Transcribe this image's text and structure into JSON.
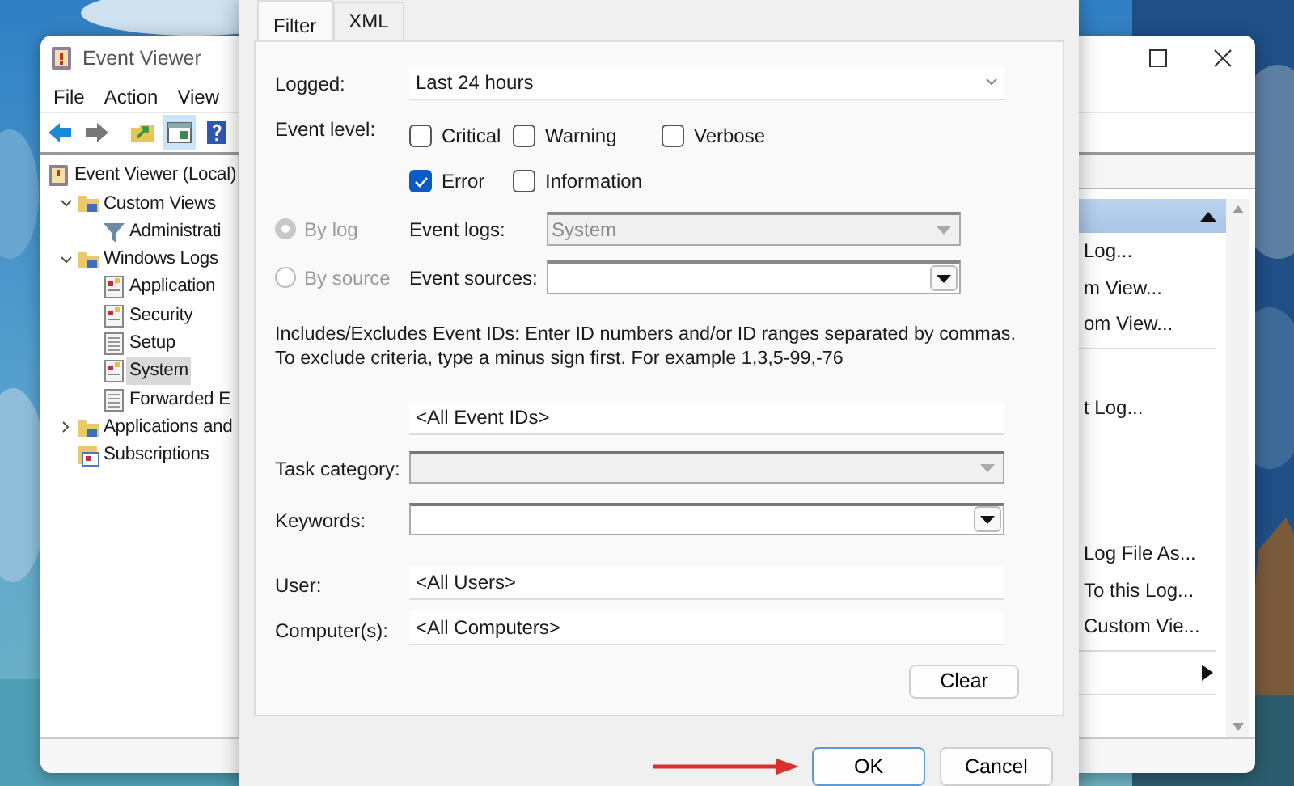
{
  "event_viewer": {
    "title": "Event Viewer",
    "menu": [
      "File",
      "Action",
      "View"
    ],
    "toolbar": [
      {
        "kind": "back",
        "selected": false
      },
      {
        "kind": "forward",
        "selected": false
      },
      {
        "kind": "up",
        "selected": false
      },
      {
        "kind": "pane",
        "selected": true
      },
      {
        "kind": "help",
        "selected": false
      }
    ],
    "tree": [
      {
        "label": "Event Viewer (Local)",
        "kind": "root",
        "selected": false,
        "children": [
          {
            "label": "Custom Views",
            "kind": "folder",
            "selected": false,
            "expanded": true,
            "children": [
              {
                "label": "Administrati",
                "kind": "filter",
                "selected": false
              }
            ]
          },
          {
            "label": "Windows Logs",
            "kind": "folder",
            "selected": false,
            "expanded": true,
            "children": [
              {
                "label": "Application",
                "kind": "log",
                "selected": false
              },
              {
                "label": "Security",
                "kind": "log",
                "selected": false
              },
              {
                "label": "Setup",
                "kind": "plainlog",
                "selected": false
              },
              {
                "label": "System",
                "kind": "log",
                "selected": true
              },
              {
                "label": "Forwarded E",
                "kind": "plainlog",
                "selected": false
              }
            ]
          },
          {
            "label": "Applications and",
            "kind": "folder",
            "selected": false,
            "expanded": false
          },
          {
            "label": "Subscriptions",
            "kind": "subscriptions",
            "selected": false
          }
        ]
      }
    ],
    "actions": {
      "header_expanded": true,
      "items": [
        {
          "kind": "item",
          "label": "Log..."
        },
        {
          "kind": "item",
          "label": "m View..."
        },
        {
          "kind": "item",
          "label": "om View..."
        },
        {
          "kind": "separator"
        },
        {
          "kind": "space"
        },
        {
          "kind": "item",
          "label": "t Log..."
        },
        {
          "kind": "space"
        },
        {
          "kind": "space"
        },
        {
          "kind": "space"
        },
        {
          "kind": "item",
          "label": "Log File As..."
        },
        {
          "kind": "item",
          "label": "To this Log..."
        },
        {
          "kind": "item",
          "label": "Custom Vie..."
        },
        {
          "kind": "separator"
        },
        {
          "kind": "submenu"
        },
        {
          "kind": "separator"
        }
      ]
    }
  },
  "dialog": {
    "tabs": [
      {
        "label": "Filter",
        "selected": true
      },
      {
        "label": "XML",
        "selected": false
      }
    ],
    "logged": {
      "label": "Logged:",
      "value": "Last 24 hours"
    },
    "event_level": {
      "label": "Event level:",
      "options": [
        {
          "label": "Critical",
          "checked": false
        },
        {
          "label": "Warning",
          "checked": false
        },
        {
          "label": "Verbose",
          "checked": false
        },
        {
          "label": "Error",
          "checked": true
        },
        {
          "label": "Information",
          "checked": false
        }
      ]
    },
    "sources": [
      {
        "option": "By log",
        "selected": true,
        "disabled": true,
        "label": "Event logs:",
        "value": "System",
        "field_disabled": true
      },
      {
        "option": "By source",
        "selected": false,
        "disabled": true,
        "label": "Event sources:",
        "field_disabled": false
      }
    ],
    "description": "Includes/Excludes Event IDs: Enter ID numbers and/or ID ranges separated by commas. To exclude criteria, type a minus sign first. For example 1,3,5-99,-76",
    "fields": [
      {
        "kind": "text",
        "value": "<All Event IDs>"
      },
      {
        "kind": "select",
        "label": "Task category:",
        "disabled": true
      },
      {
        "kind": "select",
        "label": "Keywords:",
        "disabled": false
      },
      {
        "kind": "text",
        "label": "User:",
        "value": "<All Users>"
      },
      {
        "kind": "text",
        "label": "Computer(s):",
        "value": "<All Computers>"
      }
    ],
    "clear": "Clear",
    "buttons": [
      {
        "label": "OK",
        "default": true
      },
      {
        "label": "Cancel",
        "default": false
      }
    ]
  }
}
